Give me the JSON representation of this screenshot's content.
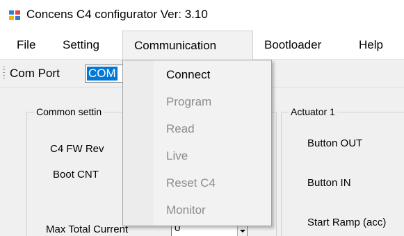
{
  "window": {
    "title": "Concens C4 configurator Ver: 3.10",
    "icon": "app-window-icon"
  },
  "menubar": {
    "items": [
      {
        "label": "File"
      },
      {
        "label": "Setting"
      },
      {
        "label": "Communication"
      },
      {
        "label": "Bootloader"
      },
      {
        "label": "Help"
      }
    ],
    "active": "Communication"
  },
  "toolstrip": {
    "com_port_label": "Com Port",
    "com_port_value": "COM"
  },
  "common_settings": {
    "title": "Common settin",
    "fw_rev_label": "C4 FW Rev",
    "boot_cnt_label": "Boot CNT",
    "max_total_current_label": "Max Total Current",
    "max_total_current_value": "0"
  },
  "actuator1": {
    "title": "Actuator 1",
    "button_out_label": "Button OUT",
    "button_in_label": "Button IN",
    "start_ramp_label": "Start Ramp (acc)"
  },
  "communication_menu": {
    "items": [
      {
        "label": "Connect",
        "enabled": true
      },
      {
        "label": "Program",
        "enabled": false
      },
      {
        "label": "Read",
        "enabled": false
      },
      {
        "label": "Live",
        "enabled": false
      },
      {
        "label": "Reset C4",
        "enabled": false
      },
      {
        "label": "Monitor",
        "enabled": false
      }
    ]
  },
  "colors": {
    "selection": "#0078d7",
    "disabled_text": "#8c8c8c",
    "control_bg": "#f0f0f0"
  }
}
